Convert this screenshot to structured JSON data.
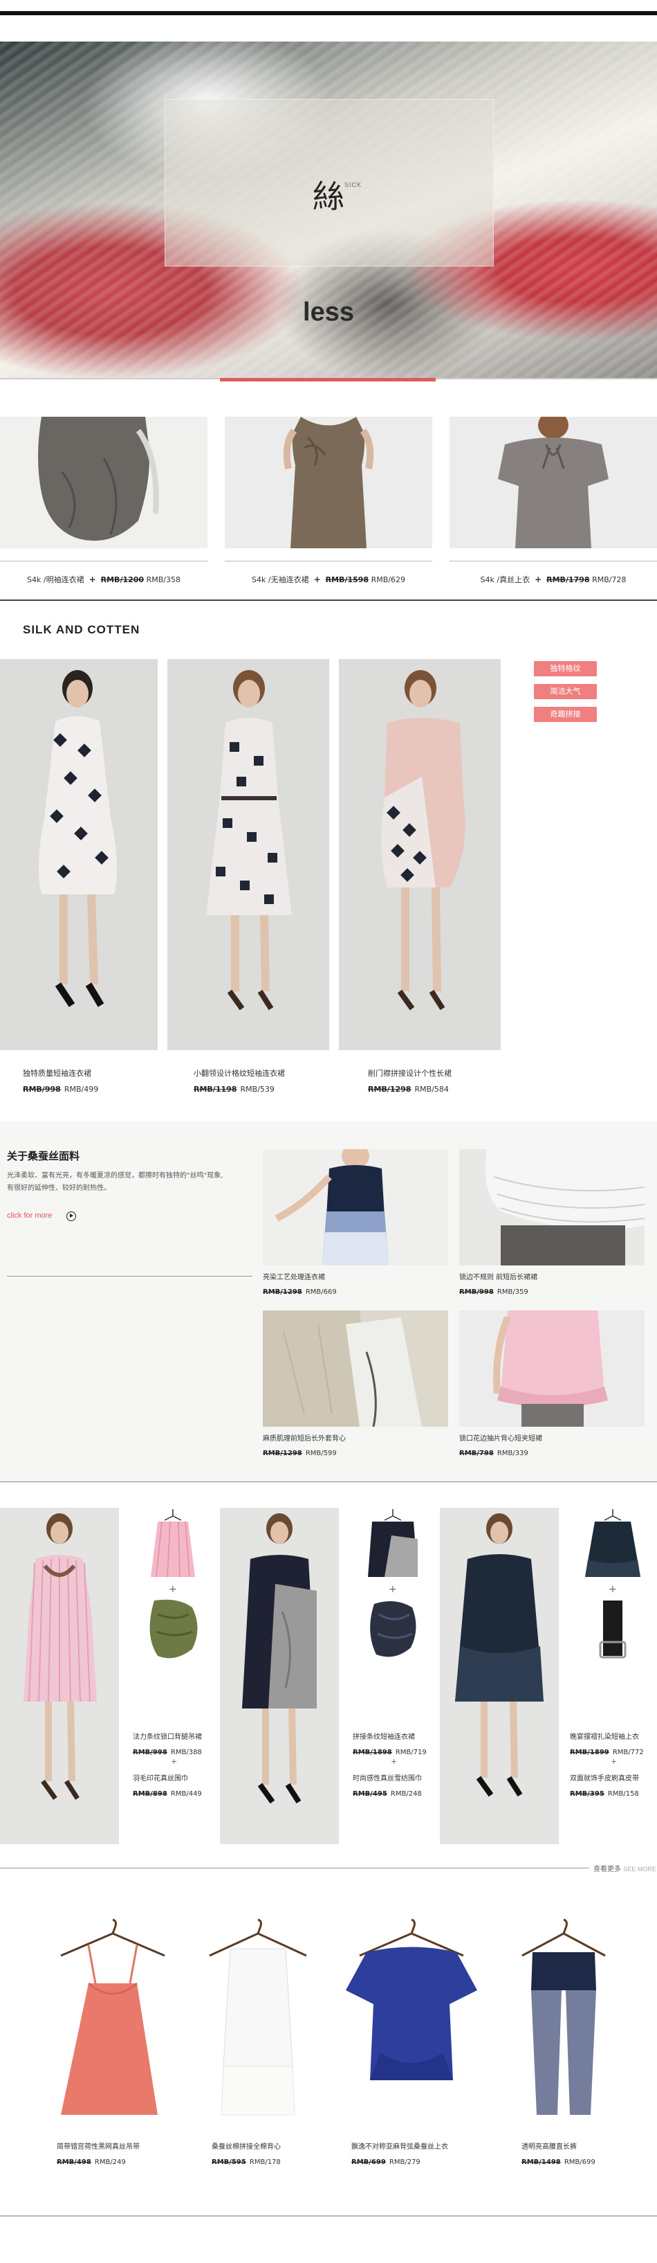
{
  "hero": {
    "cjk_title": "絲",
    "cjk_small": "SICK",
    "word": "less"
  },
  "row1": [
    {
      "name": "S4k /明袖连衣裙",
      "plus": "+",
      "old": "RMB/1200",
      "now": "RMB/358"
    },
    {
      "name": "S4k /无袖连衣裙",
      "plus": "+",
      "old": "RMB/1598",
      "now": "RMB/629"
    },
    {
      "name": "S4k /真丝上衣",
      "plus": "+",
      "old": "RMB/1798",
      "now": "RMB/728"
    }
  ],
  "section_title": "SILK AND COTTEN",
  "tags": [
    "独特格纹",
    "简洁大气",
    "奇趣拼接"
  ],
  "row2": [
    {
      "name": "独特质量短袖连衣裙",
      "old": "RMB/998",
      "now": "RMB/499"
    },
    {
      "name": "小翻领设计格纹短袖连衣裙",
      "old": "RMB/1198",
      "now": "RMB/539"
    },
    {
      "name": "削门襟拼接设计个性长裙",
      "old": "RMB/1298",
      "now": "RMB/584"
    }
  ],
  "silk": {
    "title": "关于桑蚕丝面料",
    "desc_line1": "光泽柔软、富有光亮，有冬暖夏凉的感觉，都擦时有独特的\"丝鸣\"现象,",
    "desc_line2": "有很好的延伸性、较好的耐热性。",
    "link": "click for more",
    "products": [
      {
        "name": "亮染工艺处理连衣裙",
        "old": "RMB/1298",
        "now": "RMB/669"
      },
      {
        "name": "锁边不规则 前短后长裙裙",
        "old": "RMB/998",
        "now": "RMB/359"
      },
      {
        "name": "麻质肌理前短后长外套背心",
        "old": "RMB/1298",
        "now": "RMB/599"
      },
      {
        "name": "锁口花边抽片背心短夹短裙",
        "old": "RMB/798",
        "now": "RMB/339"
      }
    ]
  },
  "combos": [
    {
      "item1": {
        "name": "法力条纹锁口背腿吊裙",
        "old": "RMB/998",
        "now": "RMB/388"
      },
      "item2": {
        "name": "羽毛印花真丝围巾",
        "old": "RMB/898",
        "now": "RMB/449"
      }
    },
    {
      "item1": {
        "name": "拼接条纹短袖连衣裙",
        "old": "RMB/1898",
        "now": "RMB/719"
      },
      "item2": {
        "name": "时尚感性真丝雪纺围巾",
        "old": "RMB/495",
        "now": "RMB/248"
      }
    },
    {
      "item1": {
        "name": "晚宴摆褶扎染短袖上衣",
        "old": "RMB/1899",
        "now": "RMB/772"
      },
      "item2": {
        "name": "双面就饰手皮刷真皮带",
        "old": "RMB/395",
        "now": "RMB/158"
      }
    }
  ],
  "combo_plus": "+",
  "see_more_cn": "查看更多",
  "see_more_en": "SEE MORE",
  "row4": [
    {
      "name": "简带错宫荷性黑网真丝吊带",
      "old": "RMB/498",
      "now": "RMB/249"
    },
    {
      "name": "桑蚕丝棉拼接全棉背心",
      "old": "RMB/595",
      "now": "RMB/178"
    },
    {
      "name": "飘逸不对称亚麻背弦桑蚕丝上衣",
      "old": "RMB/699",
      "now": "RMB/279"
    },
    {
      "name": "透明亮高腰直长裤",
      "old": "RMB/1498",
      "now": "RMB/699"
    }
  ],
  "colors": {
    "accent": "#e05a5c",
    "tag_bg": "#f07f80"
  }
}
